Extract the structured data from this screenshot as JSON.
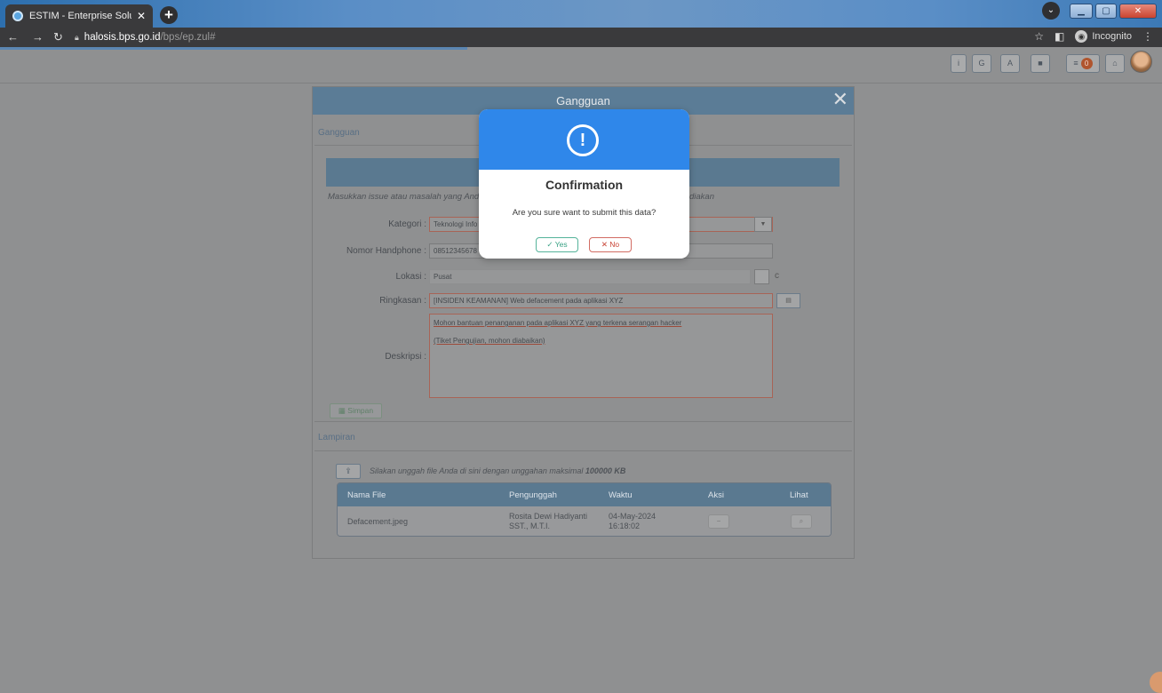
{
  "browser": {
    "tab_title": "ESTIM - Enterprise Solution for T",
    "new_tab": "+",
    "url_host": "halosis.bps.go.id",
    "url_path": "/bps/ep.zul#",
    "incognito_label": "Incognito"
  },
  "toolbar": {
    "info": "i",
    "refresh": "G",
    "alert": "A",
    "doc": "■",
    "list": "≡",
    "badge_count": "0",
    "home": "⌂"
  },
  "window": {
    "title": "Gangguan",
    "section_title": "Gangguan",
    "hint_left": "Masukkan issue atau masalah yang And",
    "hint_right": "diakan",
    "fields": {
      "kategori_label": "Kategori :",
      "kategori_value": "Teknologi Info",
      "phone_label": "Nomor Handphone :",
      "phone_value": "08512345678",
      "lokasi_label": "Lokasi :",
      "lokasi_value": "Pusat",
      "ringkasan_label": "Ringkasan :",
      "ringkasan_value": "[INSIDEN KEAMANAN] Web defacement pada aplikasi XYZ",
      "deskripsi_label": "Deskripsi :",
      "deskripsi_line1": "Mohon bantuan penanganan pada aplikasi XYZ yang terkena serangan hacker",
      "deskripsi_line2": "(Tiket Pengujian, mohon diabaikan)"
    },
    "save_label": "Simpan",
    "attachment": {
      "section_title": "Lampiran",
      "upload_hint": "Silakan unggah file Anda di sini dengan unggahan maksimal",
      "upload_max": "100000 KB",
      "columns": [
        "Nama File",
        "Pengunggah",
        "Waktu",
        "Aksi",
        "Lihat"
      ],
      "rows": [
        {
          "file": "Defacement.jpeg",
          "uploader_line1": "Rosita Dewi Hadiyanti",
          "uploader_line2": "SST., M.T.I.",
          "date": "04-May-2024",
          "time": "16:18:02"
        }
      ]
    }
  },
  "modal": {
    "icon": "!",
    "title": "Confirmation",
    "message": "Are you sure want to submit this data?",
    "yes_label": "Yes",
    "no_label": "No"
  }
}
